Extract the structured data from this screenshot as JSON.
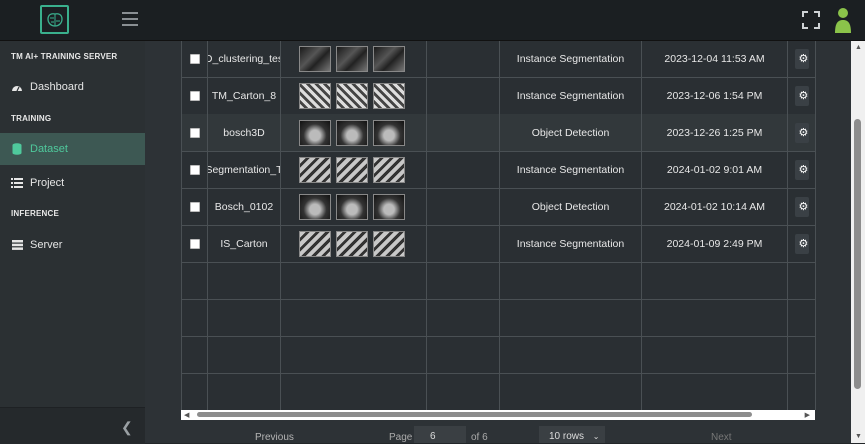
{
  "sidebar": {
    "app_title": "TM AI+ TRAINING SERVER",
    "sections": {
      "training": "TRAINING",
      "inference": "INFERENCE"
    },
    "items": {
      "dashboard": "Dashboard",
      "dataset": "Dataset",
      "project": "Project",
      "server": "Server"
    },
    "accent": "#4fc99c"
  },
  "table": {
    "rows": [
      {
        "name": "D_clustering_tes",
        "type": "Instance Segmentation",
        "date": "2023-12-04 11:53 AM",
        "thumb_style": "t1"
      },
      {
        "name": "TM_Carton_8",
        "type": "Instance Segmentation",
        "date": "2023-12-06 1:54 PM",
        "thumb_style": "t2"
      },
      {
        "name": "bosch3D",
        "type": "Object Detection",
        "date": "2023-12-26 1:25 PM",
        "thumb_style": "t3"
      },
      {
        "name": "Segmentation_T",
        "type": "Instance Segmentation",
        "date": "2024-01-02 9:01 AM",
        "thumb_style": "t4"
      },
      {
        "name": "Bosch_0102",
        "type": "Object Detection",
        "date": "2024-01-02 10:14 AM",
        "thumb_style": "t3"
      },
      {
        "name": "IS_Carton",
        "type": "Instance Segmentation",
        "date": "2024-01-09 2:49 PM",
        "thumb_style": "t4"
      }
    ],
    "empty_rows": 4
  },
  "pager": {
    "previous": "Previous",
    "page_label": "Page",
    "page_value": "6",
    "of_label": "of 6",
    "rows_select": "10 rows",
    "next": "Next"
  }
}
